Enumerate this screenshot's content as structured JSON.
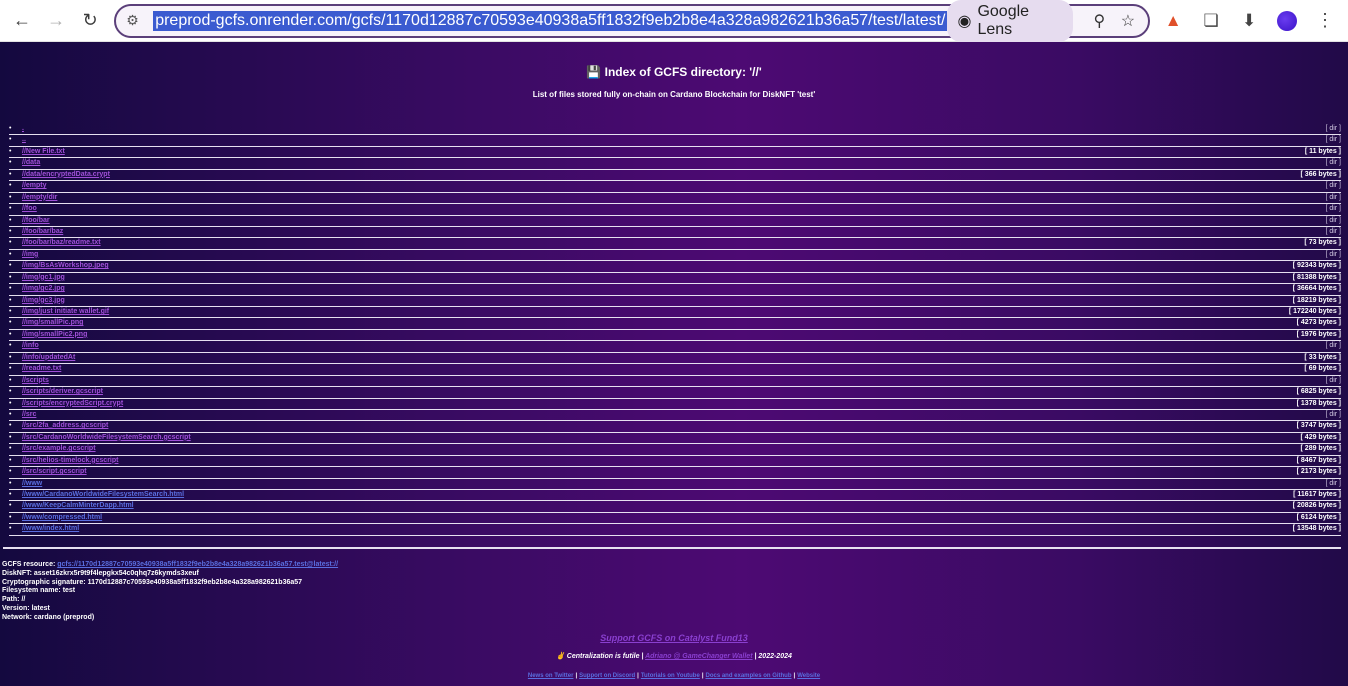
{
  "browser": {
    "url": "preprod-gcfs.onrender.com/gcfs/1170d12887c70593e40938a5ff1832f9eb2b8e4a328a982621b36a57/test/latest/",
    "lens_label": "Google Lens",
    "icons": {
      "back": "back-arrow-icon",
      "forward": "forward-arrow-icon",
      "reload": "reload-icon",
      "site_info": "site-info-icon",
      "lens": "camera-lens-icon",
      "zoom": "zoom-icon",
      "bookmark": "star-icon",
      "announce": "megaphone-icon",
      "extensions": "puzzle-icon",
      "download": "download-icon",
      "profile": "profile-avatar",
      "menu": "kebab-menu-icon"
    }
  },
  "page": {
    "title_icon": "💾",
    "title": "Index of GCFS directory: '//'",
    "subtitle": "List of files stored fully on-chain on Cardano Blockchain for DiskNFT 'test'",
    "files": [
      {
        "name": ".",
        "size": "[ dir ]"
      },
      {
        "name": "..",
        "size": "[ dir ]"
      },
      {
        "name": "//New File.txt",
        "size": "[ 11 bytes ]"
      },
      {
        "name": "//data",
        "size": "[ dir ]"
      },
      {
        "name": "//data/encryptedData.crypt",
        "size": "[ 366 bytes ]"
      },
      {
        "name": "//empty",
        "size": "[ dir ]"
      },
      {
        "name": "//empty/dir",
        "size": "[ dir ]"
      },
      {
        "name": "//foo",
        "size": "[ dir ]"
      },
      {
        "name": "//foo/bar",
        "size": "[ dir ]"
      },
      {
        "name": "//foo/bar/baz",
        "size": "[ dir ]"
      },
      {
        "name": "//foo/bar/baz/readme.txt",
        "size": "[ 73 bytes ]"
      },
      {
        "name": "//img",
        "size": "[ dir ]"
      },
      {
        "name": "//img/BsAsWorkshop.jpeg",
        "size": "[ 92343 bytes ]"
      },
      {
        "name": "//img/gc1.jpg",
        "size": "[ 81388 bytes ]"
      },
      {
        "name": "//img/gc2.jpg",
        "size": "[ 36664 bytes ]"
      },
      {
        "name": "//img/gc3.jpg",
        "size": "[ 18219 bytes ]"
      },
      {
        "name": "//img/just initiate wallet.gif",
        "size": "[ 172240 bytes ]"
      },
      {
        "name": "//img/smallPic.png",
        "size": "[ 4273 bytes ]"
      },
      {
        "name": "//img/smallPic2.png",
        "size": "[ 1976 bytes ]"
      },
      {
        "name": "//info",
        "size": "[ dir ]"
      },
      {
        "name": "//info/updatedAt",
        "size": "[ 33 bytes ]"
      },
      {
        "name": "//readme.txt",
        "size": "[ 69 bytes ]"
      },
      {
        "name": "//scripts",
        "size": "[ dir ]"
      },
      {
        "name": "//scripts/deriver.gcscript",
        "size": "[ 6825 bytes ]"
      },
      {
        "name": "//scripts/encryptedScript.crypt",
        "size": "[ 1378 bytes ]"
      },
      {
        "name": "//src",
        "size": "[ dir ]"
      },
      {
        "name": "//src/2fa_address.gcscript",
        "size": "[ 3747 bytes ]"
      },
      {
        "name": "//src/CardanoWorldwideFilesystemSearch.gcscript",
        "size": "[ 429 bytes ]"
      },
      {
        "name": "//src/example.gcscript",
        "size": "[ 289 bytes ]"
      },
      {
        "name": "//src/helios-timelock.gcscript",
        "size": "[ 8467 bytes ]"
      },
      {
        "name": "//src/script.gcscript",
        "size": "[ 2173 bytes ]"
      },
      {
        "name": "//www",
        "size": "[ dir ]"
      },
      {
        "name": "//www/CardanoWorldwideFilesystemSearch.html",
        "size": "[ 11617 bytes ]"
      },
      {
        "name": "//www/KeepCalmMinterDapp.html",
        "size": "[ 20826 bytes ]"
      },
      {
        "name": "//www/compressed.html",
        "size": "[ 6124 bytes ]"
      },
      {
        "name": "//www/index.html",
        "size": "[ 13548 bytes ]"
      }
    ],
    "info": {
      "resource_label": "GCFS resource:",
      "resource_link": "gcfs://1170d12887c70593e40938a5ff1832f9eb2b8e4a328a982621b36a57.test@latest://",
      "disknft": "DiskNFT: asset16zkrx5r9t9f4lepgkx54c0qhq7z6kymds3xeuf",
      "signature": "Cryptographic signature: 1170d12887c70593e40938a5ff1832f9eb2b8e4a328a982621b36a57",
      "fs_name": "Filesystem name: test",
      "path": "Path: //",
      "version": "Version: latest",
      "network": "Network: cardano (preprod)"
    },
    "support_link": "Support GCFS on Catalyst Fund13",
    "footer": {
      "hand": "✌",
      "centralization": "Centralization is futile |",
      "author_link": "Adriano @ GameChanger Wallet",
      "years": "| 2022-2024",
      "links": [
        "News on Twitter",
        "Support on Discord",
        "Tutorials on Youtube",
        "Docs and examples on Github",
        "Website"
      ],
      "separator": "|"
    }
  }
}
